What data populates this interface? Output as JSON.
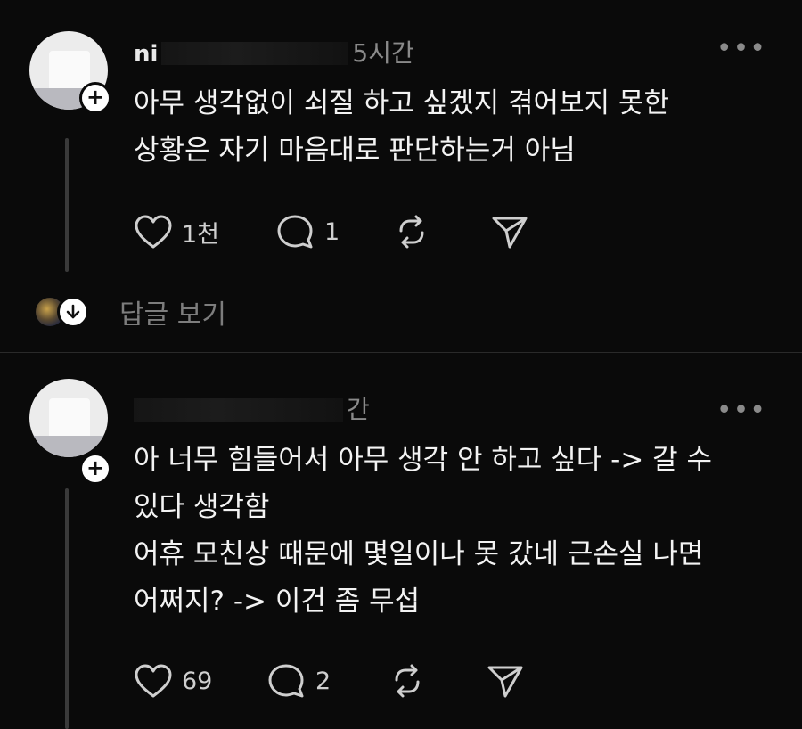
{
  "posts": [
    {
      "name_fragment": "ni",
      "time": "5시간",
      "more": "•••",
      "lines": [
        "아무 생각없이 쇠질 하고 싶겠지 겪어보지 못한",
        "상황은 자기 마음대로 판단하는거 아님"
      ],
      "likes": "1천",
      "comments": "1",
      "follow_symbol": "+"
    },
    {
      "name_fragment": "",
      "time": "간",
      "more": "•••",
      "lines": [
        "아 너무 힘들어서 아무 생각 안 하고 싶다 -> 갈 수",
        "있다 생각함",
        "어휴 모친상 때문에 몇일이나 못 갔네 근손실 나면",
        "어쩌지? -> 이건 좀 무섭"
      ],
      "likes": "69",
      "comments": "2",
      "follow_symbol": "+"
    }
  ],
  "replies": {
    "label": "답글 보기"
  },
  "icons": {
    "like": "heart-icon",
    "comment": "comment-bubble-icon",
    "repost": "repost-icon",
    "share": "send-icon",
    "expand": "arrow-down-icon"
  },
  "colors": {
    "background": "#0a0a0a",
    "text": "#f3f3f3",
    "muted": "#8a8a8a"
  }
}
